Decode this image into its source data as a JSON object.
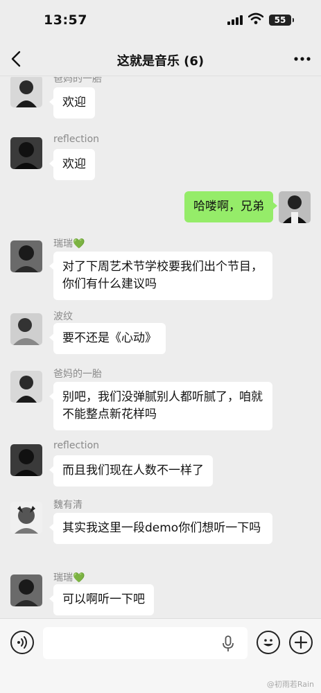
{
  "status_bar": {
    "time": "13:57",
    "battery": "55"
  },
  "header": {
    "title": "这就是音乐 (6)"
  },
  "messages": [
    {
      "sender": "爸妈的一胎",
      "text": "欢迎"
    },
    {
      "sender": "reflection",
      "text": "欢迎"
    },
    {
      "sender": "",
      "text": "哈喽啊，兄弟"
    },
    {
      "sender": "瑞瑞💚",
      "text": "对了下周艺术节学校要我们出个节目，你们有什么建议吗"
    },
    {
      "sender": "波纹",
      "text": "要不还是《心动》"
    },
    {
      "sender": "爸妈的一胎",
      "text": "别吧，我们没弹腻别人都听腻了，咱就不能整点新花样吗"
    },
    {
      "sender": "reflection",
      "text": "而且我们现在人数不一样了"
    },
    {
      "sender": "魏有清",
      "text": "其实我这里一段demo你们想听一下吗"
    },
    {
      "sender": "瑞瑞💚",
      "text": "可以啊听一下吧"
    }
  ],
  "input": {
    "placeholder": ""
  },
  "watermark": "@初雨若Rain",
  "colors": {
    "background": "#ededed",
    "sent_bubble": "#95ec69",
    "received_bubble": "#ffffff"
  },
  "icons": [
    "back-arrow-icon",
    "more-dots-icon",
    "voice-icon",
    "microphone-icon",
    "emoji-icon",
    "plus-icon"
  ]
}
